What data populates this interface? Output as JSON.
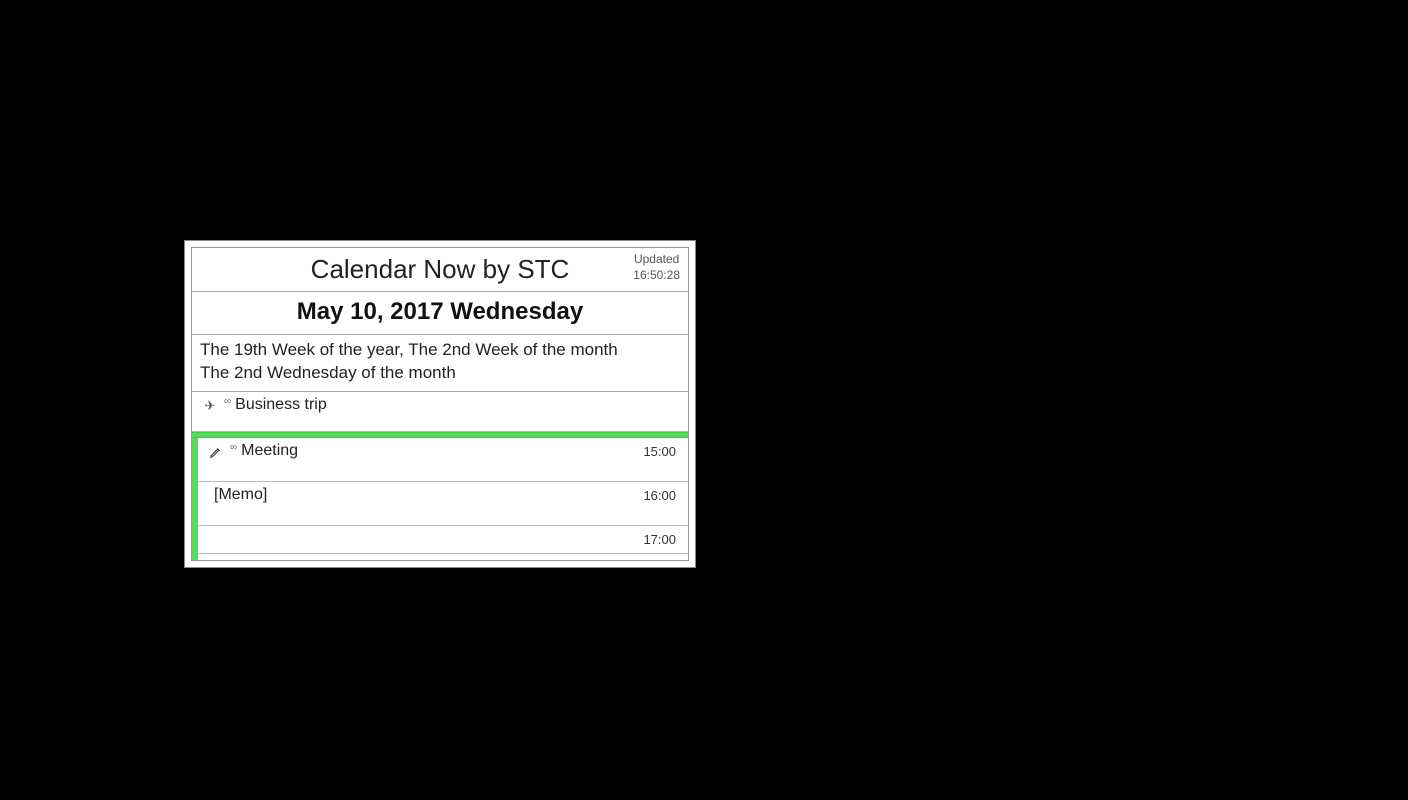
{
  "header": {
    "title": "Calendar Now by STC",
    "updated_label": "Updated",
    "updated_time": "16:50:28"
  },
  "date": {
    "full": "May 10, 2017 Wednesday"
  },
  "weekinfo": {
    "line1": "The 19th Week of the year, The 2nd Week of the month",
    "line2": "The 2nd Wednesday of the month"
  },
  "events": {
    "allday": {
      "title": "Business trip"
    },
    "timed": [
      {
        "title": "Meeting",
        "time": "15:00"
      },
      {
        "title": "[Memo]",
        "time": "16:00"
      },
      {
        "title": "",
        "time": "17:00"
      }
    ]
  }
}
